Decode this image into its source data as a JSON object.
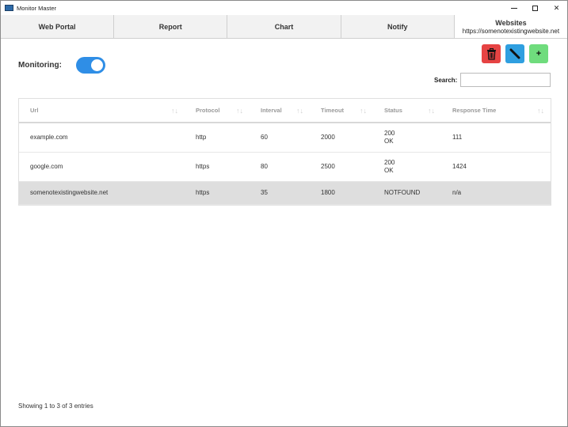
{
  "window": {
    "title": "Monitor Master",
    "minimize": "—",
    "maximize": "□",
    "close": "✕"
  },
  "tabs": [
    {
      "label": "Web Portal",
      "sub": ""
    },
    {
      "label": "Report",
      "sub": ""
    },
    {
      "label": "Chart",
      "sub": ""
    },
    {
      "label": "Notify",
      "sub": ""
    },
    {
      "label": "Websites",
      "sub": "https://somenotexistingwebsite.net"
    }
  ],
  "actions": {
    "delete_icon": "trash-icon",
    "edit_icon": "pencil-icon",
    "add_label": "+"
  },
  "monitoring": {
    "label": "Monitoring:",
    "enabled": true
  },
  "search": {
    "label": "Search:",
    "value": "",
    "placeholder": ""
  },
  "table": {
    "columns": [
      "Url",
      "Protocol",
      "Interval",
      "Timeout",
      "Status",
      "Response Time"
    ],
    "sort_glyph": "↑↓",
    "rows": [
      {
        "url": "example.com",
        "protocol": "http",
        "interval": "60",
        "timeout": "2000",
        "status1": "200",
        "status2": "OK",
        "response": "111"
      },
      {
        "url": "google.com",
        "protocol": "https",
        "interval": "80",
        "timeout": "2500",
        "status1": "200",
        "status2": "OK",
        "response": "1424"
      },
      {
        "url": "somenotexistingwebsite.net",
        "protocol": "https",
        "interval": "35",
        "timeout": "1800",
        "status1": "NOTFOUND",
        "status2": "",
        "response": "n/a"
      }
    ]
  },
  "footer": {
    "info": "Showing 1 to 3 of 3 entries"
  },
  "colors": {
    "delete": "#e64343",
    "edit": "#2f9fe0",
    "add": "#6fdc7d",
    "toggle": "#2f8ee6",
    "selected_row": "#dedede"
  }
}
